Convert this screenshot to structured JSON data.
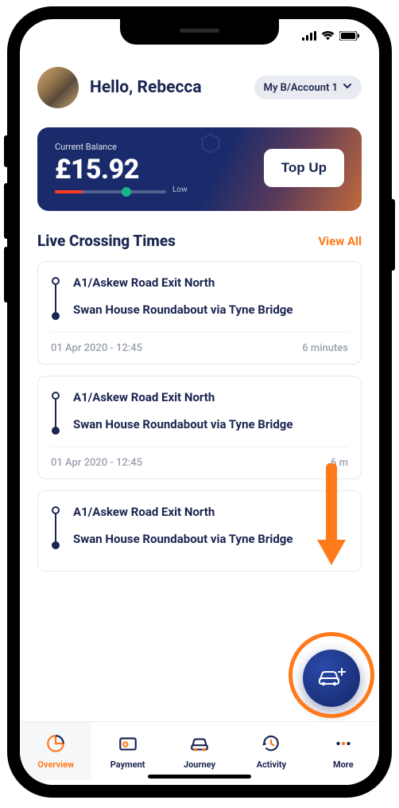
{
  "statusbar": {
    "signal_icon": "signal",
    "wifi_icon": "wifi",
    "battery_icon": "battery"
  },
  "header": {
    "greeting": "Hello, Rebecca",
    "account_label": "My B/Account 1"
  },
  "balance": {
    "label": "Current Balance",
    "amount": "£15.92",
    "bar_label": "Low",
    "topup_label": "Top Up"
  },
  "crossings": {
    "title": "Live Crossing Times",
    "view_all": "View All",
    "items": [
      {
        "from": "A1/Askew Road Exit North",
        "to": "Swan House Roundabout via Tyne Bridge",
        "time": "01 Apr 2020 - 12:45",
        "duration": "6 minutes"
      },
      {
        "from": "A1/Askew Road Exit North",
        "to": "Swan House Roundabout via Tyne Bridge",
        "time": "01 Apr 2020 - 12:45",
        "duration": "6 m"
      },
      {
        "from": "A1/Askew Road Exit North",
        "to": "Swan House Roundabout via Tyne Bridge",
        "time": "",
        "duration": ""
      }
    ]
  },
  "tabs": {
    "overview": "Overview",
    "payment": "Payment",
    "journey": "Journey",
    "activity": "Activity",
    "more": "More"
  }
}
